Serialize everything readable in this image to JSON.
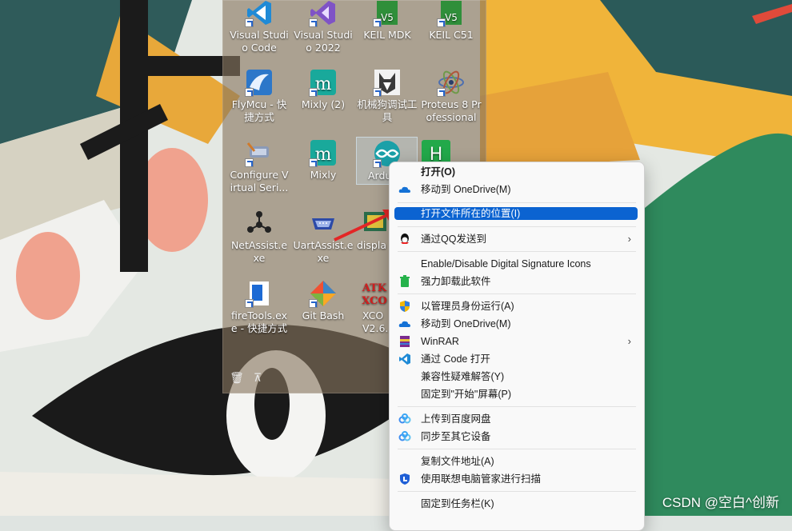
{
  "desktop": {
    "icons": [
      {
        "name": "visual-studio-code-icon",
        "label": "Visual Studio Code"
      },
      {
        "name": "visual-studio-2022-icon",
        "label": "Visual Studio 2022"
      },
      {
        "name": "keil-mdk-icon",
        "label": "KEIL MDK"
      },
      {
        "name": "keil-c51-icon",
        "label": "KEIL C51"
      },
      {
        "name": "flymcu-icon",
        "label": "FlyMcu - 快捷方式"
      },
      {
        "name": "mixly-2-icon",
        "label": "Mixly (2)"
      },
      {
        "name": "robot-dog-debug-icon",
        "label": "机械狗调试工具"
      },
      {
        "name": "proteus-icon",
        "label": "Proteus 8 Professional"
      },
      {
        "name": "configure-virtual-serial-icon",
        "label": "Configure Virtual Seri..."
      },
      {
        "name": "mixly-icon",
        "label": "Mixly"
      },
      {
        "name": "arduino-icon",
        "label": "Ardu"
      },
      {
        "name": "netassist-icon",
        "label": "NetAssist.exe"
      },
      {
        "name": "uartassist-icon",
        "label": "UartAssist.exe"
      },
      {
        "name": "display-icon",
        "label": "displa"
      },
      {
        "name": "firetools-icon",
        "label": "fireTools.exe - 快捷方式"
      },
      {
        "name": "git-bash-icon",
        "label": "Git Bash"
      },
      {
        "name": "xcom-icon",
        "label": "XCO V2.6."
      }
    ],
    "toolbar": {
      "delete_icon": "trash-icon",
      "pin_icon": "pin-icon"
    }
  },
  "context_menu": {
    "items": [
      {
        "label": "打开(O)",
        "icon": ""
      },
      {
        "label": "移动到 OneDrive(M)",
        "icon": "onedrive-icon"
      },
      {
        "label": "打开文件所在的位置(I)",
        "icon": ""
      },
      {
        "label": "通过QQ发送到",
        "icon": "qq-icon",
        "submenu": "›"
      },
      {
        "label": "Enable/Disable Digital Signature Icons",
        "icon": ""
      },
      {
        "label": "强力卸载此软件",
        "icon": "uninstall-icon"
      },
      {
        "label": "以管理员身份运行(A)",
        "icon": "shield-icon"
      },
      {
        "label": "移动到 OneDrive(M)",
        "icon": "onedrive-icon"
      },
      {
        "label": "WinRAR",
        "icon": "winrar-icon",
        "submenu": "›"
      },
      {
        "label": "通过 Code 打开",
        "icon": "vscode-icon"
      },
      {
        "label": "兼容性疑难解答(Y)",
        "icon": ""
      },
      {
        "label": "固定到\"开始\"屏幕(P)",
        "icon": ""
      },
      {
        "label": "上传到百度网盘",
        "icon": "baidu-netdisk-icon"
      },
      {
        "label": "同步至其它设备",
        "icon": "baidu-netdisk-icon"
      },
      {
        "label": "复制文件地址(A)",
        "icon": ""
      },
      {
        "label": "使用联想电脑管家进行扫描",
        "icon": "lenovo-icon"
      },
      {
        "label": "固定到任务栏(K)",
        "icon": ""
      }
    ],
    "highlight_color": "#0b63d1"
  },
  "watermark": "CSDN @空白^创新"
}
